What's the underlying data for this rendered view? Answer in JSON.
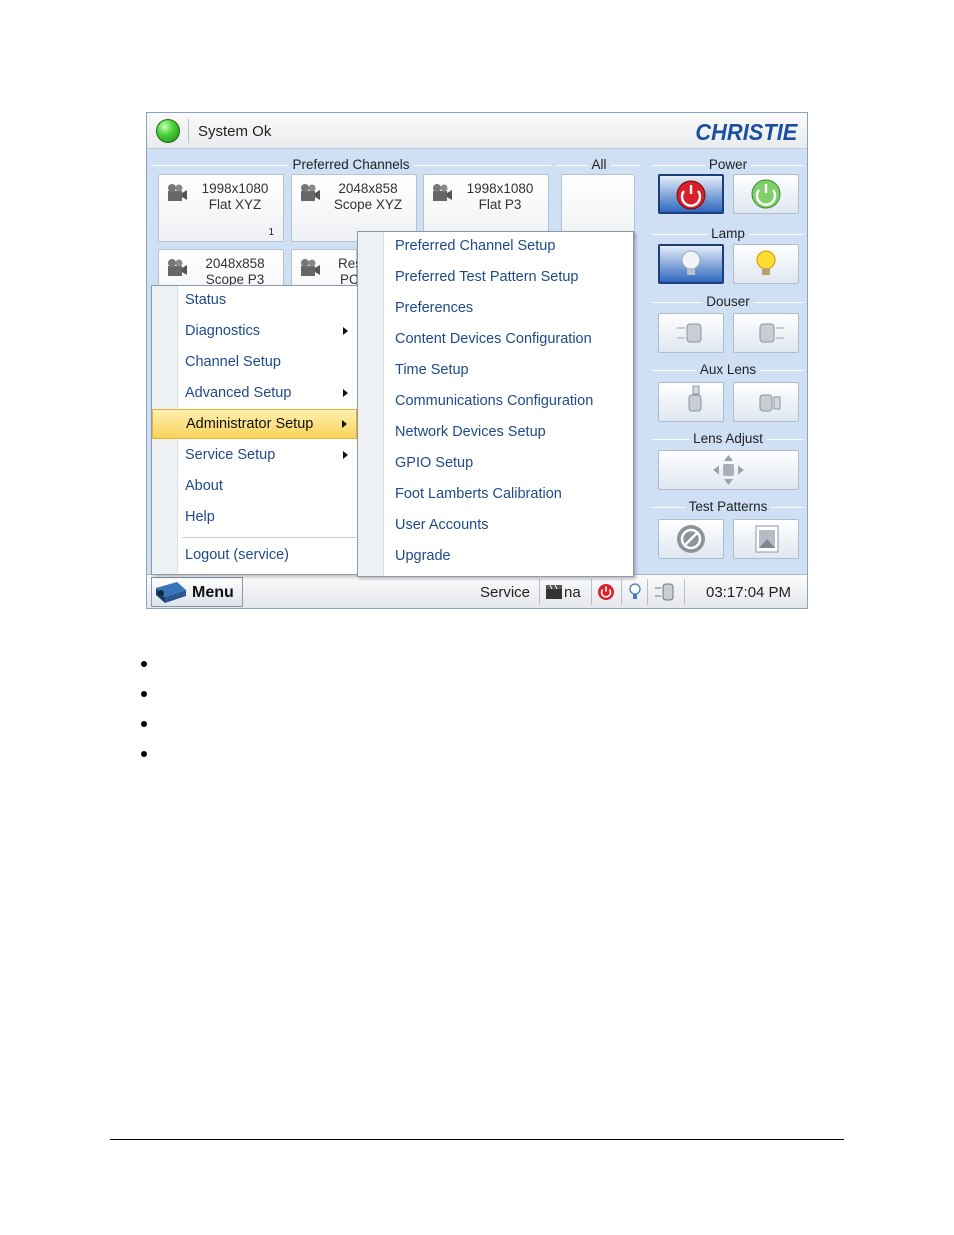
{
  "header": {
    "status_text": "System Ok",
    "logo_text": "CHRISTIE"
  },
  "groups": {
    "preferred_channels": "Preferred Channels",
    "all": "All",
    "power": "Power",
    "lamp": "Lamp",
    "douser": "Douser",
    "aux_lens": "Aux Lens",
    "lens_adjust": "Lens Adjust",
    "test_patterns": "Test Patterns"
  },
  "channels": [
    {
      "line1": "1998x1080",
      "line2": "Flat XYZ",
      "num": "1"
    },
    {
      "line1": "2048x858",
      "line2": "Scope XYZ",
      "num": ""
    },
    {
      "line1": "1998x1080",
      "line2": "Flat P3",
      "num": ""
    },
    {
      "line1": "2048x858",
      "line2": "Scope P3",
      "num": ""
    },
    {
      "line1": "Res",
      "line2": "PC",
      "num": ""
    }
  ],
  "main_menu": {
    "items": [
      {
        "label": "Status",
        "submenu": false
      },
      {
        "label": "Diagnostics",
        "submenu": true
      },
      {
        "label": "Channel Setup",
        "submenu": false
      },
      {
        "label": "Advanced Setup",
        "submenu": true
      },
      {
        "label": "Administrator Setup",
        "submenu": true,
        "highlighted": true
      },
      {
        "label": "Service Setup",
        "submenu": true
      },
      {
        "label": "About",
        "submenu": false
      },
      {
        "label": "Help",
        "submenu": false
      },
      {
        "label": "Logout (service)",
        "submenu": false
      }
    ]
  },
  "sub_menu": {
    "items": [
      "Preferred Channel Setup",
      "Preferred Test Pattern Setup",
      "Preferences",
      "Content Devices Configuration",
      "Time Setup",
      "Communications Configuration",
      "Network Devices Setup",
      "GPIO Setup",
      "Foot Lamberts Calibration",
      "User Accounts",
      "Upgrade"
    ]
  },
  "statusbar": {
    "menu_label": "Menu",
    "user_level": "Service",
    "channel": "na",
    "time": "03:17:04 PM"
  },
  "colors": {
    "panel": "#cfe0f4",
    "menu_text": "#1f4a8a",
    "highlight": "#f9d35b",
    "power_on": "#d8202a",
    "power_off": "#5fc24f"
  }
}
